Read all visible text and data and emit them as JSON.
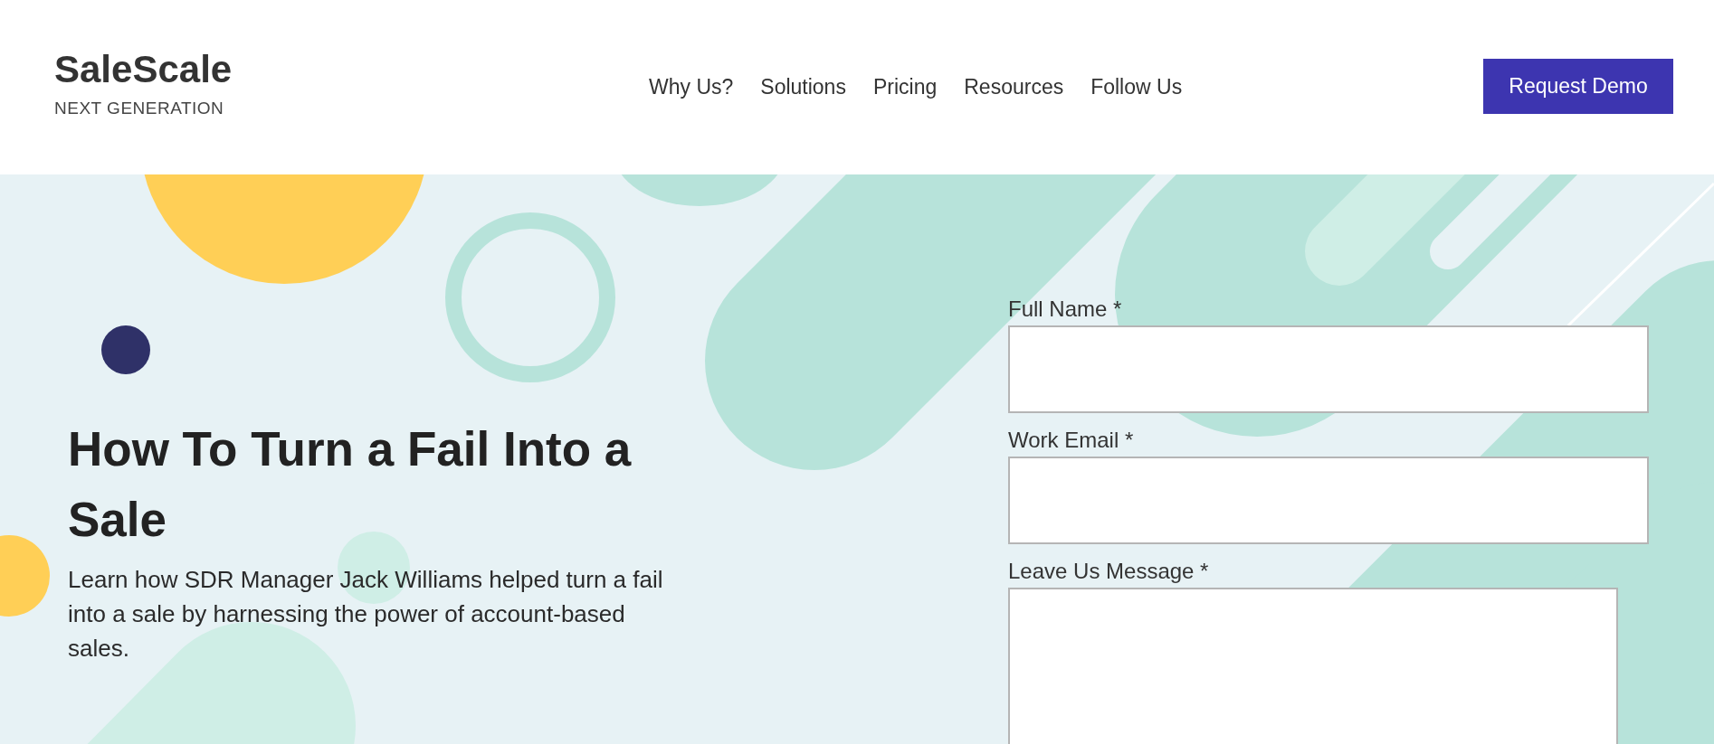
{
  "header": {
    "logo": "SaleScale",
    "tagline": "NEXT GENERATION",
    "nav": [
      "Why Us?",
      "Solutions",
      "Pricing",
      "Resources",
      "Follow Us"
    ],
    "cta": "Request Demo"
  },
  "hero": {
    "title": "How To Turn a Fail Into a Sale",
    "description": "Learn how SDR Manager Jack Williams helped turn a fail into a sale by harnessing the power of account-based sales."
  },
  "form": {
    "fields": [
      {
        "label": "Full Name *",
        "kind": "input"
      },
      {
        "label": "Work Email *",
        "kind": "input"
      },
      {
        "label": "Leave Us Message *",
        "kind": "textarea"
      }
    ]
  }
}
